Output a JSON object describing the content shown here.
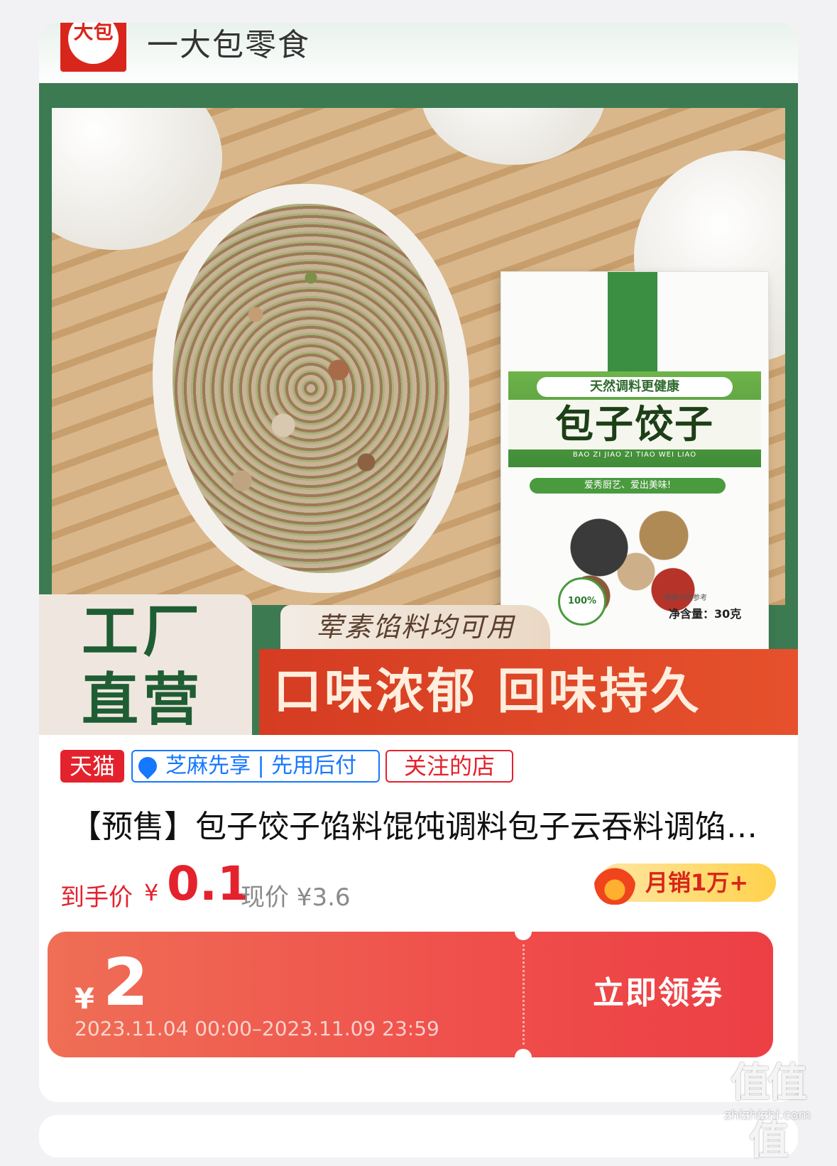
{
  "shop": {
    "logo_text": "大包",
    "name": "一大包零食"
  },
  "banner": {
    "package": {
      "top_label": "天然调料更健康",
      "title": "包子饺子",
      "pinyin": "BAO ZI JIAO ZI TIAO WEI LIAO",
      "slogan": "爱秀厨艺、爱出美味!",
      "badge": "100%",
      "image_note": "图案仅供参考",
      "net_weight": "净含量：30克"
    },
    "slogan_main": "工厂直营",
    "subtitle": "荤素馅料均可用",
    "red_bar_text": "口味浓郁 回味持久"
  },
  "tags": {
    "tmall": "天猫",
    "zhima": "芝麻先享 | 先用后付",
    "follow": "关注的店"
  },
  "product": {
    "title": "【预售】包子饺子馅料馄饨调料包子云吞料调馅…"
  },
  "price": {
    "label": "到手价",
    "yen": "¥",
    "value": "0.1",
    "now_price": "现价 ¥3.6",
    "sales": "月销1万+"
  },
  "coupon": {
    "yen": "¥",
    "amount": "2",
    "valid": "2023.11.04 00:00–2023.11.09 23:59",
    "button": "立即领券"
  },
  "watermark": {
    "text": "值值值",
    "sub": "zhizhizhi.com"
  },
  "colors": {
    "brand_red": "#e4222d",
    "coupon_start": "#ef6e55",
    "coupon_end": "#ec3f45",
    "zhima_blue": "#1677ff",
    "banner_green": "#3c7a52"
  }
}
